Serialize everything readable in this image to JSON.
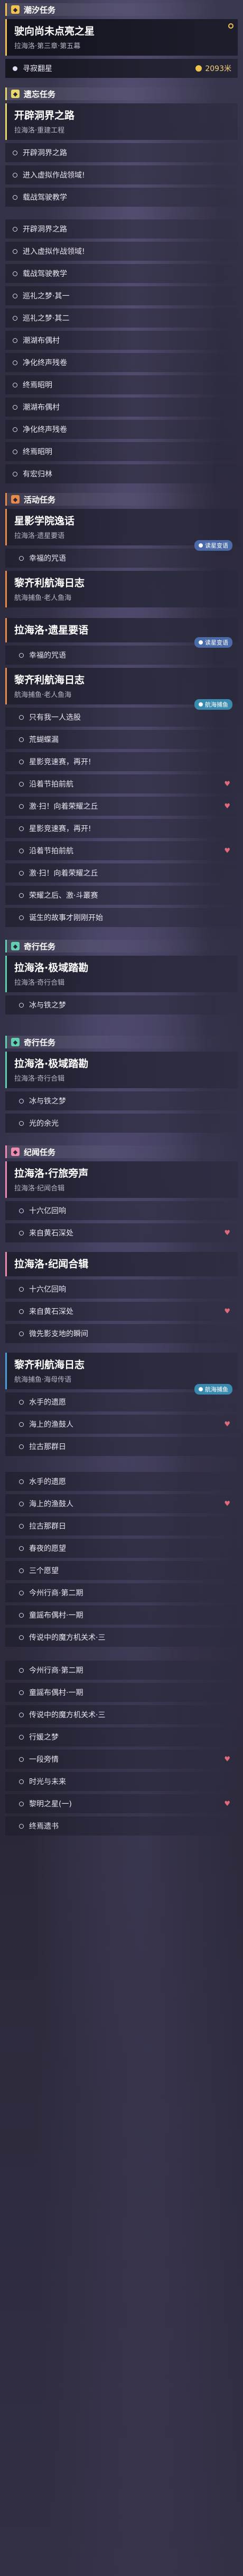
{
  "colors": {
    "trailblaze": "#f2c14e",
    "daily": "#e8d86a",
    "event": "#e88a4a",
    "adventure": "#5fd0b0",
    "companion": "#f08ab0",
    "synesthesia": "#4aa0d8",
    "memory": "#8a6ad8"
  },
  "sections": [
    {
      "id": "trailblaze",
      "label": "潮汐任务",
      "icon": "star-icon",
      "color": "#f2c14e",
      "quests": [
        {
          "title": "驶向尚未点亮之星",
          "sub": "拉海洛·第三章·第五幕",
          "selected": true,
          "steps": [
            {
              "text": "寻寂翻星",
              "reward": "2093米",
              "active": true
            }
          ]
        }
      ]
    },
    {
      "id": "daily",
      "label": "遗忘任务",
      "icon": "diamond-icon",
      "color": "#e8d86a",
      "quests": [
        {
          "title": "开辟洞界之路",
          "sub": "拉海洛·重建工程",
          "steps": [
            {
              "text": "开辟洞界之路"
            },
            {
              "text": "进入虚拟作战领域!"
            },
            {
              "text": "载战驾驶教学"
            }
          ]
        }
      ],
      "extra_steps": [
        {
          "text": "开辟洞界之路"
        },
        {
          "text": "进入虚拟作战领域!"
        },
        {
          "text": "载战驾驶教学"
        },
        {
          "text": "巡礼之梦·其一"
        },
        {
          "text": "巡礼之梦·其二"
        },
        {
          "text": "潮湖布偶村"
        },
        {
          "text": "净化终声残卷"
        },
        {
          "text": "终焉昭明"
        },
        {
          "text": "潮湖布偶村"
        },
        {
          "text": "净化终声残卷"
        },
        {
          "text": "终焉昭明"
        },
        {
          "text": "有宏归林"
        }
      ]
    },
    {
      "id": "event",
      "label": "活动任务",
      "icon": "flag-icon",
      "color": "#e88a4a",
      "quests": [
        {
          "title": "星影学院逸话",
          "sub": "拉海洛·遗星要语",
          "steps": [
            {
              "text": "幸福的咒语"
            }
          ]
        },
        {
          "title": "黎齐利航海日志",
          "sub": "航海捕鱼·老人鱼海",
          "steps": [
            {
              "text": "幸福的咒语"
            }
          ]
        }
      ]
    }
  ],
  "mid_quests": [
    {
      "title": "拉海洛·遗星要语",
      "steps": [
        "幸福的咒语"
      ]
    },
    {
      "title": "黎齐利航海日志",
      "sub": "航海捕鱼·老人鱼海",
      "steps": [
        "只有我一人选股",
        "荒蝴蝶漏",
        "星影竞速赛，再开!",
        "沿着节拍前航",
        "激·扫！向着荣耀之丘",
        "星影竞速赛，再开!",
        "沿着节拍前航",
        "激·扫！向着荣耀之丘",
        "荣耀之后、激·斗叢赛",
        "诞生的故事才刚刚开始"
      ]
    }
  ],
  "adventure_1": {
    "label": "奇行任务",
    "title": "拉海洛·极域踏勘",
    "sub": "拉海洛·奇行合辑",
    "steps": [
      "冰与铁之梦"
    ]
  },
  "adventure_2": {
    "label": "奇行任务",
    "title": "拉海洛·极域踏勘",
    "sub": "拉海洛·奇行合辑",
    "steps": [
      "冰与铁之梦",
      "光的余光"
    ]
  },
  "companion": {
    "label": "纪闻任务",
    "title": "拉海洛·行旅旁声",
    "sub": "拉海洛·纪闻合辑",
    "steps": [
      "十六亿回响",
      "来自黄石深处"
    ]
  },
  "companion_2": {
    "title": "拉海洛·纪闻合辑",
    "steps": [
      "十六亿回响",
      "来自黄石深处",
      "微先影支地的瞬间"
    ]
  },
  "synth_quest": {
    "title": "黎齐利航海日志",
    "sub": "航海捕鱼·海母传语",
    "steps": [
      "水手的遗愿",
      "海上的渔鼓人",
      "拉古那群日"
    ]
  },
  "synth_quest_2": {
    "steps": [
      "水手的遗愿",
      "海上的渔鼓人",
      "拉古那群日",
      "春夜的愿望",
      "三个愿望",
      "今州行商·第二期",
      "童謡布偶村·一期",
      "传说中的魔方机关术·三"
    ]
  },
  "memory_steps": [
    "今州行商·第二期",
    "童謡布偶村·一期",
    "传说中的魔方机关术·三",
    "行媛之梦",
    "一段旁情",
    "时光与未来",
    "黎明之星(一)",
    "终焉遗书"
  ],
  "tags": {
    "event_tag": "读星变语",
    "sailing_tag": "航海捕鱼",
    "sailing_tag2": "航海捕鱼",
    "memory_tag": "潮汐残渊",
    "memory_tag2": "潮汐残渊"
  }
}
